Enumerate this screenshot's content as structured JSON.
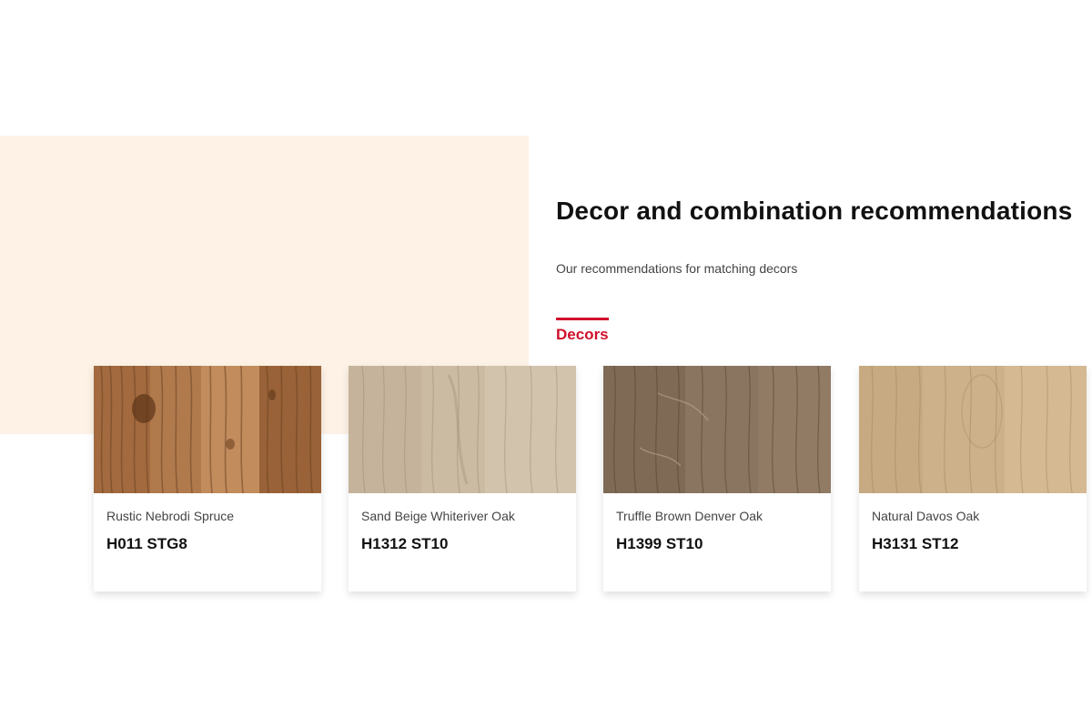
{
  "section": {
    "title": "Decor and combination recommendations",
    "subtitle": "Our recommendations for matching decors",
    "tab_label": "Decors",
    "accent_color": "#d0112b",
    "panel_color": "#fdf2e5"
  },
  "decors": [
    {
      "name": "Rustic Nebrodi Spruce",
      "code": "H011 STG8",
      "swatch": "rustic-spruce-wood-texture"
    },
    {
      "name": "Sand Beige Whiteriver Oak",
      "code": "H1312 ST10",
      "swatch": "sand-beige-oak-wood-texture"
    },
    {
      "name": "Truffle Brown Denver Oak",
      "code": "H1399 ST10",
      "swatch": "truffle-brown-oak-wood-texture"
    },
    {
      "name": "Natural Davos Oak",
      "code": "H3131 ST12",
      "swatch": "natural-oak-wood-texture"
    }
  ]
}
